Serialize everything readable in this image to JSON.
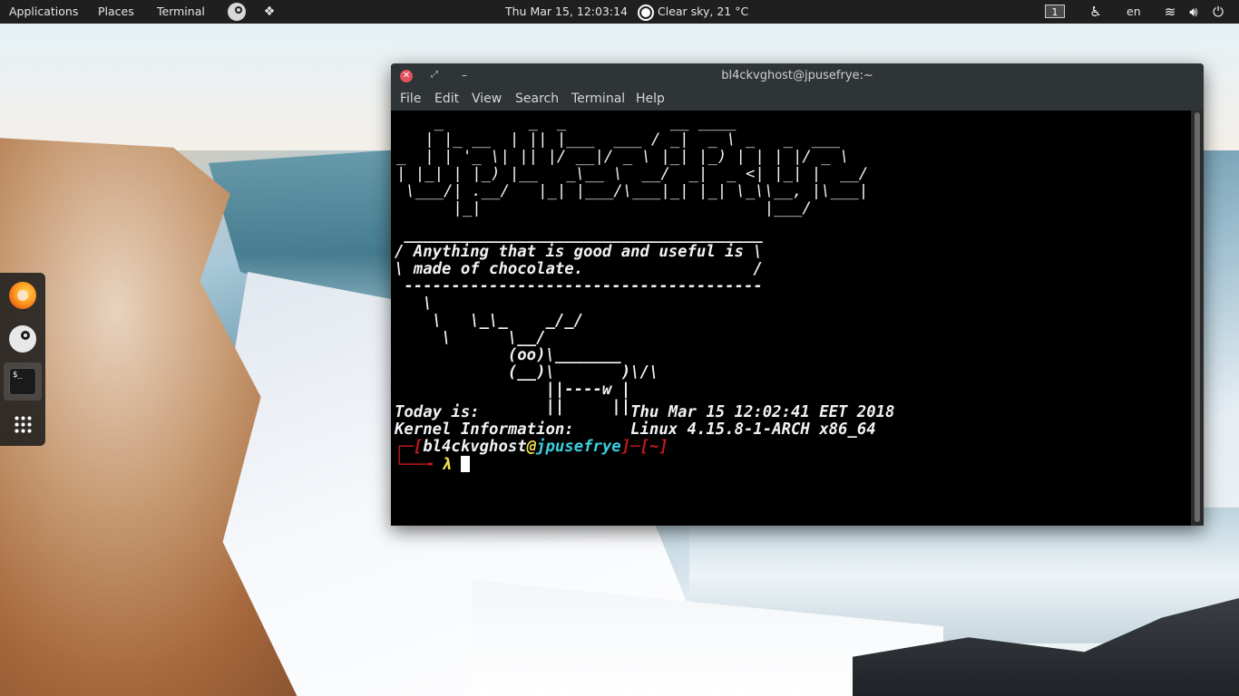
{
  "topbar": {
    "applications": "Applications",
    "places": "Places",
    "terminal": "Terminal",
    "datetime": "Thu Mar 15, 12:03:14",
    "weather": "Clear sky, 21 °C",
    "workspace": "1",
    "language": "en",
    "icons": [
      "steam-icon",
      "dropbox-icon",
      "weather-sun-icon",
      "accessibility-icon",
      "wifi-icon",
      "volume-icon",
      "power-icon"
    ]
  },
  "dock": {
    "items": [
      "firefox-icon",
      "steam-icon",
      "terminal-icon",
      "app-grid-icon"
    ]
  },
  "window": {
    "title": "bl4ckvghost@jpusefrye:~",
    "menu": [
      "File",
      "Edit",
      "View",
      "Search",
      "Terminal",
      "Help"
    ]
  },
  "terminal": {
    "ascii_art": "    _         _  _           __ ____\n   | |_ __  | || |___  ___ / _|  _ \\ _   _  ___\n_  | | '_ \\| || |/ __|/ _ \\ |_| |_) | | | |/ _ \\\n| |_| | |_) |__   _\\__ \\  __/  _|  _ <| |_| |  __/\n \\___/| .__/   |_| |___/\\___|_| |_| \\_\\\\__, |\\___|\n      |_|                              |___/",
    "cowsay": " ______________________________________\n/ Anything that is good and useful is \\\n\\ made of chocolate.                  /\n --------------------------------------\n   \\\n    \\   \\_\\_    _/_/\n     \\      \\__/\n            (oo)\\_______\n            (__)\\       )\\/\\\n                ||----w |\n                ||     ||",
    "today_label": "Today is:",
    "today_value": "Thu Mar 15 12:02:41 EET 2018",
    "kernel_label": "Kernel Information:",
    "kernel_value": "Linux 4.15.8-1-ARCH x86_64",
    "prompt_user": "bl4ckvghost",
    "prompt_at": "@",
    "prompt_host": "jpusefrye",
    "prompt_dir": "~",
    "prompt_symbol": "λ"
  },
  "colors": {
    "topbar_bg": "#1f1f1f",
    "prompt_red": "#c21a1a",
    "prompt_yellow": "#f1e04a",
    "prompt_cyan": "#3ad1e0",
    "close_button": "#e0525c"
  }
}
